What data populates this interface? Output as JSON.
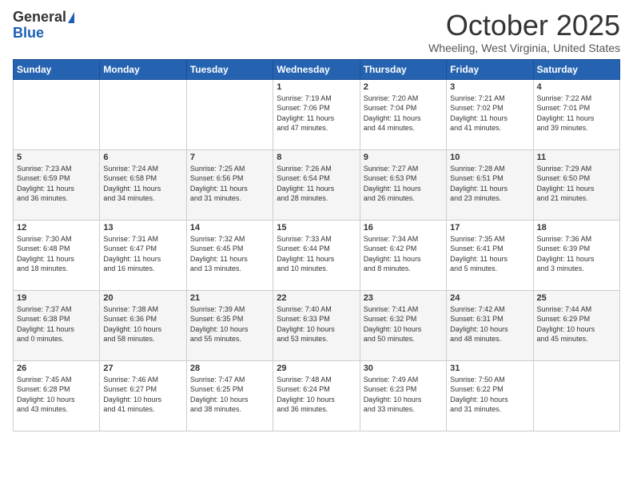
{
  "logo": {
    "general": "General",
    "blue": "Blue"
  },
  "header": {
    "month": "October 2025",
    "location": "Wheeling, West Virginia, United States"
  },
  "days_of_week": [
    "Sunday",
    "Monday",
    "Tuesday",
    "Wednesday",
    "Thursday",
    "Friday",
    "Saturday"
  ],
  "weeks": [
    [
      {
        "day": "",
        "detail": ""
      },
      {
        "day": "",
        "detail": ""
      },
      {
        "day": "",
        "detail": ""
      },
      {
        "day": "1",
        "detail": "Sunrise: 7:19 AM\nSunset: 7:06 PM\nDaylight: 11 hours\nand 47 minutes."
      },
      {
        "day": "2",
        "detail": "Sunrise: 7:20 AM\nSunset: 7:04 PM\nDaylight: 11 hours\nand 44 minutes."
      },
      {
        "day": "3",
        "detail": "Sunrise: 7:21 AM\nSunset: 7:02 PM\nDaylight: 11 hours\nand 41 minutes."
      },
      {
        "day": "4",
        "detail": "Sunrise: 7:22 AM\nSunset: 7:01 PM\nDaylight: 11 hours\nand 39 minutes."
      }
    ],
    [
      {
        "day": "5",
        "detail": "Sunrise: 7:23 AM\nSunset: 6:59 PM\nDaylight: 11 hours\nand 36 minutes."
      },
      {
        "day": "6",
        "detail": "Sunrise: 7:24 AM\nSunset: 6:58 PM\nDaylight: 11 hours\nand 34 minutes."
      },
      {
        "day": "7",
        "detail": "Sunrise: 7:25 AM\nSunset: 6:56 PM\nDaylight: 11 hours\nand 31 minutes."
      },
      {
        "day": "8",
        "detail": "Sunrise: 7:26 AM\nSunset: 6:54 PM\nDaylight: 11 hours\nand 28 minutes."
      },
      {
        "day": "9",
        "detail": "Sunrise: 7:27 AM\nSunset: 6:53 PM\nDaylight: 11 hours\nand 26 minutes."
      },
      {
        "day": "10",
        "detail": "Sunrise: 7:28 AM\nSunset: 6:51 PM\nDaylight: 11 hours\nand 23 minutes."
      },
      {
        "day": "11",
        "detail": "Sunrise: 7:29 AM\nSunset: 6:50 PM\nDaylight: 11 hours\nand 21 minutes."
      }
    ],
    [
      {
        "day": "12",
        "detail": "Sunrise: 7:30 AM\nSunset: 6:48 PM\nDaylight: 11 hours\nand 18 minutes."
      },
      {
        "day": "13",
        "detail": "Sunrise: 7:31 AM\nSunset: 6:47 PM\nDaylight: 11 hours\nand 16 minutes."
      },
      {
        "day": "14",
        "detail": "Sunrise: 7:32 AM\nSunset: 6:45 PM\nDaylight: 11 hours\nand 13 minutes."
      },
      {
        "day": "15",
        "detail": "Sunrise: 7:33 AM\nSunset: 6:44 PM\nDaylight: 11 hours\nand 10 minutes."
      },
      {
        "day": "16",
        "detail": "Sunrise: 7:34 AM\nSunset: 6:42 PM\nDaylight: 11 hours\nand 8 minutes."
      },
      {
        "day": "17",
        "detail": "Sunrise: 7:35 AM\nSunset: 6:41 PM\nDaylight: 11 hours\nand 5 minutes."
      },
      {
        "day": "18",
        "detail": "Sunrise: 7:36 AM\nSunset: 6:39 PM\nDaylight: 11 hours\nand 3 minutes."
      }
    ],
    [
      {
        "day": "19",
        "detail": "Sunrise: 7:37 AM\nSunset: 6:38 PM\nDaylight: 11 hours\nand 0 minutes."
      },
      {
        "day": "20",
        "detail": "Sunrise: 7:38 AM\nSunset: 6:36 PM\nDaylight: 10 hours\nand 58 minutes."
      },
      {
        "day": "21",
        "detail": "Sunrise: 7:39 AM\nSunset: 6:35 PM\nDaylight: 10 hours\nand 55 minutes."
      },
      {
        "day": "22",
        "detail": "Sunrise: 7:40 AM\nSunset: 6:33 PM\nDaylight: 10 hours\nand 53 minutes."
      },
      {
        "day": "23",
        "detail": "Sunrise: 7:41 AM\nSunset: 6:32 PM\nDaylight: 10 hours\nand 50 minutes."
      },
      {
        "day": "24",
        "detail": "Sunrise: 7:42 AM\nSunset: 6:31 PM\nDaylight: 10 hours\nand 48 minutes."
      },
      {
        "day": "25",
        "detail": "Sunrise: 7:44 AM\nSunset: 6:29 PM\nDaylight: 10 hours\nand 45 minutes."
      }
    ],
    [
      {
        "day": "26",
        "detail": "Sunrise: 7:45 AM\nSunset: 6:28 PM\nDaylight: 10 hours\nand 43 minutes."
      },
      {
        "day": "27",
        "detail": "Sunrise: 7:46 AM\nSunset: 6:27 PM\nDaylight: 10 hours\nand 41 minutes."
      },
      {
        "day": "28",
        "detail": "Sunrise: 7:47 AM\nSunset: 6:25 PM\nDaylight: 10 hours\nand 38 minutes."
      },
      {
        "day": "29",
        "detail": "Sunrise: 7:48 AM\nSunset: 6:24 PM\nDaylight: 10 hours\nand 36 minutes."
      },
      {
        "day": "30",
        "detail": "Sunrise: 7:49 AM\nSunset: 6:23 PM\nDaylight: 10 hours\nand 33 minutes."
      },
      {
        "day": "31",
        "detail": "Sunrise: 7:50 AM\nSunset: 6:22 PM\nDaylight: 10 hours\nand 31 minutes."
      },
      {
        "day": "",
        "detail": ""
      }
    ]
  ]
}
